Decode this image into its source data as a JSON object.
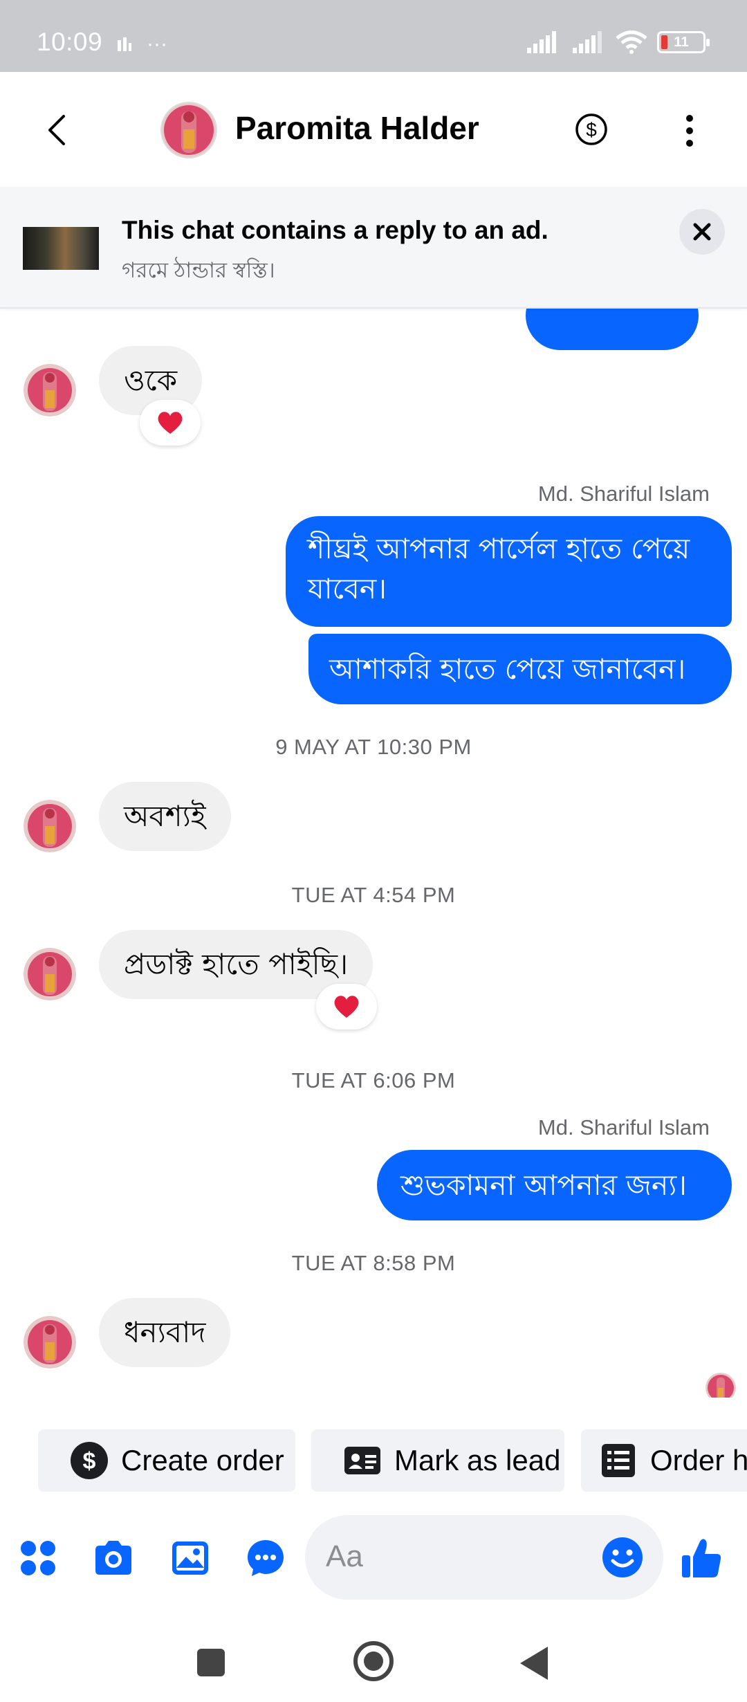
{
  "status_bar": {
    "time": "10:09",
    "battery": "11",
    "dots": "···"
  },
  "header": {
    "contact_name": "Paromita Halder",
    "back_icon": "chevron-left-icon",
    "payment_icon": "dollar-circle-icon",
    "menu_icon": "more-vertical-icon"
  },
  "ad_banner": {
    "title": "This chat contains a reply to an ad.",
    "subtitle": "গরমে ঠান্ডার স্বস্তি।",
    "close_label": "✕"
  },
  "messages": {
    "m1": {
      "text": "ওকে",
      "reaction": "heart"
    },
    "sender1": "Md. Shariful Islam",
    "m2_line1": "শীঘ্রই আপনার পার্সেল হাতে পেয়ে",
    "m2_line2": "যাবেন।",
    "m3": "আশাকরি হাতে পেয়ে জানাবেন।",
    "ts1": "9 MAY AT 10:30 PM",
    "m4": "অবশ্যই",
    "ts2": "TUE AT 4:54 PM",
    "m5": {
      "text": "প্রডাক্ট হাতে পাইছি।",
      "reaction": "heart"
    },
    "ts3": "TUE AT 6:06 PM",
    "sender2": "Md. Shariful Islam",
    "m6": "শুভকামনা আপনার জন্য।",
    "ts4": "TUE AT 8:58 PM",
    "m7": "ধন্যবাদ"
  },
  "quick_actions": [
    {
      "label": "Create order",
      "icon": "dollar-circle-icon"
    },
    {
      "label": "Mark as lead",
      "icon": "contact-card-icon"
    },
    {
      "label": "Order h",
      "icon": "order-list-icon"
    }
  ],
  "composer": {
    "placeholder": "Aa"
  },
  "colors": {
    "accent": "#0866ff",
    "incoming_bubble": "#f0f0f0",
    "status_bar": "#c9cacd"
  }
}
